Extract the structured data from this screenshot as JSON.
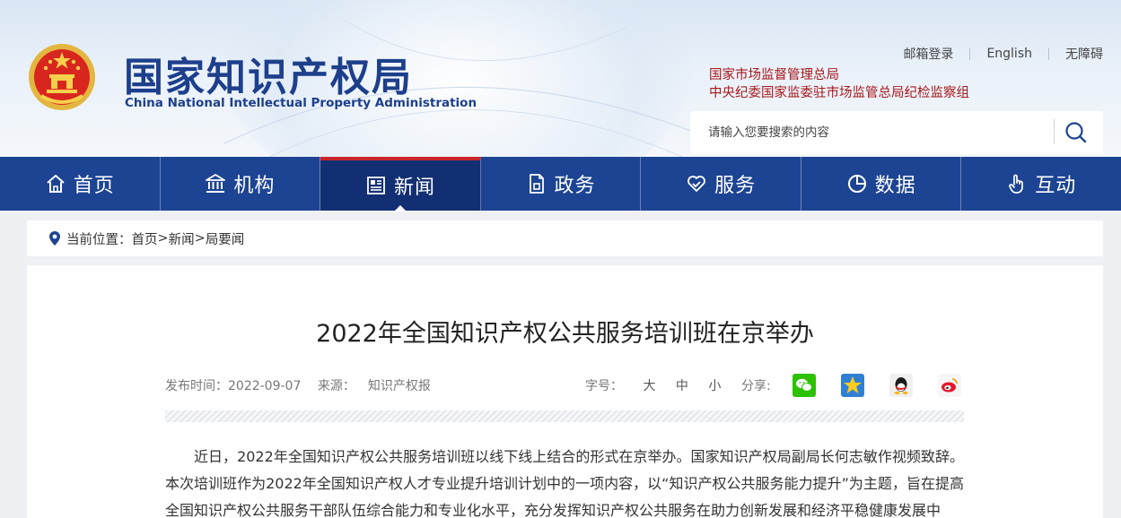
{
  "header": {
    "logo_cn": "国家知识产权局",
    "logo_en": "China National Intellectual Property Administration",
    "top_links": [
      "邮箱登录",
      "English",
      "无障碍"
    ],
    "related_links": [
      "国家市场监督管理总局",
      "中央纪委国家监委驻市场监管总局纪检监察组"
    ],
    "search_placeholder": "请输入您要搜索的内容"
  },
  "nav": {
    "items": [
      {
        "label": "首页",
        "icon": "home-icon"
      },
      {
        "label": "机构",
        "icon": "institution-icon"
      },
      {
        "label": "新闻",
        "icon": "newspaper-icon",
        "active": true
      },
      {
        "label": "政务",
        "icon": "document-icon"
      },
      {
        "label": "服务",
        "icon": "heart-hand-icon"
      },
      {
        "label": "数据",
        "icon": "pie-chart-icon"
      },
      {
        "label": "互动",
        "icon": "hand-pointer-icon"
      }
    ],
    "active_color": "#c8262a",
    "bar_color": "#1d4493"
  },
  "breadcrumb": {
    "prefix": "当前位置：",
    "items": [
      "首页",
      "新闻",
      "局要闻"
    ],
    "separator": ">"
  },
  "article": {
    "title": "2022年全国知识产权公共服务培训班在京举办",
    "publish_label": "发布时间：",
    "publish_date": "2022-09-07",
    "source_label": "来源：",
    "source": "知识产权报",
    "font_label": "字号：",
    "font_sizes": [
      "大",
      "中",
      "小"
    ],
    "share_label": "分享:",
    "share_icons": [
      "wechat-icon",
      "qzone-icon",
      "qq-icon",
      "weibo-icon"
    ],
    "body": "近日，2022年全国知识产权公共服务培训班以线下线上结合的形式在京举办。国家知识产权局副局长何志敏作视频致辞。本次培训班作为2022年全国知识产权人才专业提升培训计划中的一项内容，以“知识产权公共服务能力提升”为主题，旨在提高全国知识产权公共服务干部队伍综合能力和专业化水平，充分发挥知识产权公共服务在助力创新发展和经济平稳健康发展中"
  }
}
